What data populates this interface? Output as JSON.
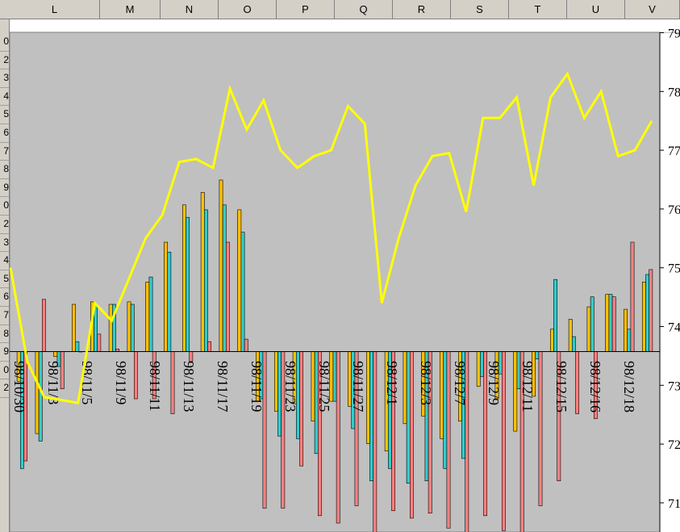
{
  "spreadsheet": {
    "column_headers": [
      "L",
      "M",
      "N",
      "O",
      "P",
      "Q",
      "R",
      "S",
      "T",
      "U",
      "V"
    ],
    "row_header_digits": [
      "0",
      "2",
      "3",
      "4",
      "5",
      "6",
      "7",
      "8",
      "9",
      "0",
      "2",
      "3",
      "4",
      "5",
      "6",
      "7",
      "8",
      "9",
      "0",
      "2"
    ]
  },
  "colors": {
    "plot_background": "#c0c0c0",
    "line": "#ffff00",
    "bar_orange": "#ffc000",
    "bar_teal": "#33cccc",
    "bar_red": "#ff8080",
    "bar_outline": "#000000"
  },
  "chart_data": {
    "type": "bar",
    "x_tick_labels": [
      "98/10/30",
      "98/11/3",
      "98/11/5",
      "98/11/9",
      "98/11/11",
      "98/11/13",
      "98/11/17",
      "98/11/19",
      "98/11/23",
      "98/11/25",
      "98/11/27",
      "98/12/1",
      "98/12/3",
      "98/12/7",
      "98/12/9",
      "98/12/11",
      "98/12/15",
      "98/12/16",
      "98/12/18"
    ],
    "right_axis": {
      "ticks": [
        "79",
        "78",
        "77",
        "76",
        "75",
        "74",
        "73",
        "72",
        "71"
      ],
      "ylim": [
        70.5,
        79
      ]
    },
    "line_series": {
      "values": [
        75.0,
        73.4,
        72.8,
        72.75,
        72.7,
        74.4,
        74.1,
        74.8,
        75.5,
        75.9,
        76.8,
        76.85,
        76.7,
        78.05,
        77.35,
        77.85,
        77.0,
        76.7,
        76.9,
        77.0,
        77.75,
        77.45,
        74.4,
        75.5,
        76.4,
        76.9,
        76.95,
        75.95,
        77.55,
        77.55,
        77.9,
        76.4,
        77.9,
        78.3,
        77.55,
        78.0,
        76.9,
        77.0,
        77.5
      ]
    },
    "bar_groups": [
      [
        -12,
        -47,
        -44
      ],
      [
        -33,
        -36,
        21
      ],
      [
        -2,
        -6,
        -15
      ],
      [
        19,
        4,
        0
      ],
      [
        20,
        19,
        7
      ],
      [
        19,
        19,
        1
      ],
      [
        20,
        19,
        -19
      ],
      [
        28,
        30,
        -19
      ],
      [
        44,
        40,
        -25
      ],
      [
        59,
        54,
        -4
      ],
      [
        64,
        57,
        4
      ],
      [
        69,
        59,
        44
      ],
      [
        57,
        48,
        5
      ],
      [
        -20,
        -19,
        -63
      ],
      [
        -24,
        -34,
        -63
      ],
      [
        -21,
        -35,
        -46
      ],
      [
        -28,
        -41,
        -66
      ],
      [
        -20,
        -20,
        -69
      ],
      [
        -22,
        -31,
        -62
      ],
      [
        -37,
        -52,
        -78
      ],
      [
        -40,
        -47,
        -64
      ],
      [
        -29,
        -53,
        -67
      ],
      [
        -26,
        -52,
        -65
      ],
      [
        -35,
        -47,
        -71
      ],
      [
        -28,
        -43,
        -74
      ],
      [
        -14,
        -10,
        -66
      ],
      [
        -19,
        -9,
        -72
      ],
      [
        -32,
        -15,
        -76
      ],
      [
        -18,
        -3,
        -62
      ],
      [
        9,
        29,
        -52
      ],
      [
        13,
        6,
        -25
      ],
      [
        18,
        22,
        -27
      ],
      [
        23,
        23,
        22
      ],
      [
        17,
        9,
        44
      ],
      [
        28,
        31,
        33
      ]
    ],
    "bar_series_scale": {
      "ylim": [
        -70,
        70
      ]
    }
  }
}
